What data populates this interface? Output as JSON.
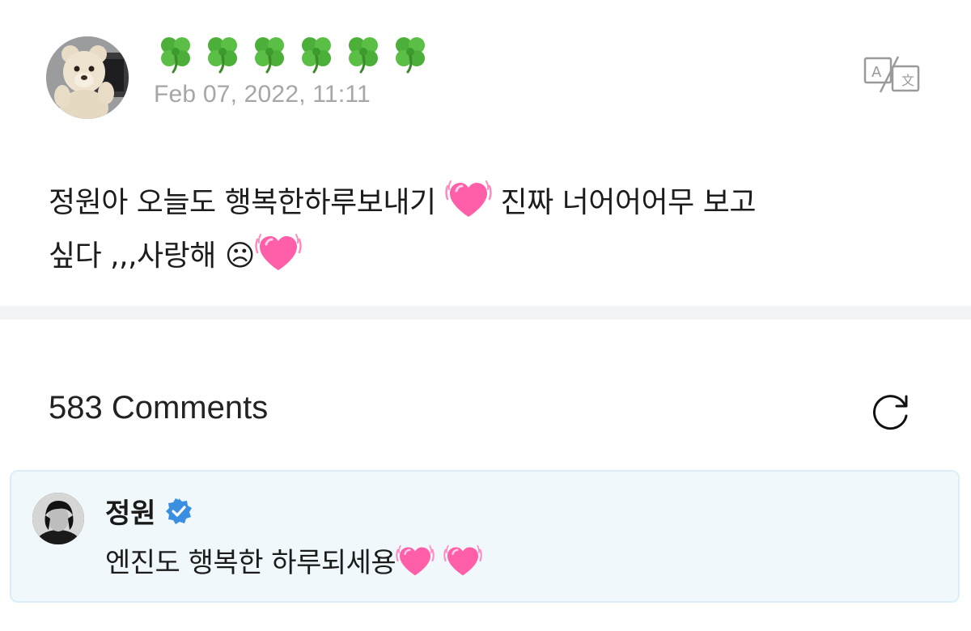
{
  "post": {
    "author": "🍀🍀🍀🍀🍀🍀",
    "date": "Feb 07, 2022, 11:11",
    "body_line1": "정원아 오늘도 행복한하루보내기",
    "body_line1b": "진짜 너어어어무 보고",
    "body_line2": "싶다 ,,,사랑해 ☹",
    "translate_icon": "translate-icon"
  },
  "comments": {
    "count_label": "583 Comments",
    "refresh_icon": "refresh-icon"
  },
  "comment": {
    "author": "정원",
    "verified_icon": "verified-badge-icon",
    "text": "엔진도 행복한 하루되세용"
  },
  "colors": {
    "date": "#a6a6a6",
    "divider": "#f2f3f5",
    "comment_bg": "#f0f8fc",
    "comment_border": "#dbeef7",
    "verified": "#3b8fe0",
    "heart": "#ff5fa8"
  }
}
